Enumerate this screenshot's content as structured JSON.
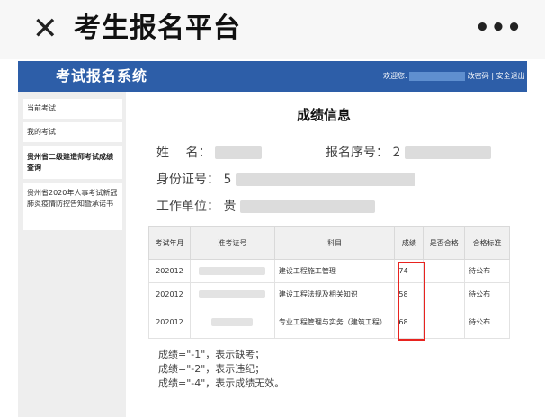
{
  "titlebar": {
    "close_icon": "close-icon",
    "close_glyph": "✕",
    "title": "考生报名平台",
    "more_glyph": "•••"
  },
  "sysbar": {
    "title": "考试报名系统",
    "welcome": "欢迎您:",
    "change_password": "改密码",
    "separator": "|",
    "logout": "安全退出",
    "bg_color": "#2d5ea8"
  },
  "sidebar": {
    "items": [
      {
        "label": "当前考试"
      },
      {
        "label": "我的考试"
      },
      {
        "label": "贵州省二级建造师考试成绩查询"
      },
      {
        "label": "贵州省2020年人事考试新冠肺炎疫情防控告知暨承诺书"
      }
    ]
  },
  "main": {
    "title": "成绩信息",
    "name_label": "姓　 名：",
    "reg_label": "报名序号：",
    "reg_prefix": "2",
    "id_label": "身份证号：",
    "id_prefix": "5",
    "work_label": "工作单位：",
    "work_prefix": "贵"
  },
  "table": {
    "headers": [
      "考试年月",
      "准考证号",
      "科目",
      "成绩",
      "是否合格",
      "合格标准"
    ],
    "rows": [
      {
        "exam_month": "202012",
        "subject": "建设工程施工管理",
        "score": "74",
        "pass": "",
        "standard": "待公布"
      },
      {
        "exam_month": "202012",
        "subject": "建设工程法规及相关知识",
        "score": "58",
        "pass": "",
        "standard": "待公布"
      },
      {
        "exam_month": "202012",
        "subject": "专业工程管理与实务（建筑工程）",
        "score": "68",
        "pass": "",
        "standard": "待公布"
      }
    ],
    "highlight_color": "#e8231f"
  },
  "notes": [
    "成绩=\"-1\"，表示缺考；",
    "成绩=\"-2\"，表示违纪；",
    "成绩=\"-4\"，表示成绩无效。"
  ]
}
